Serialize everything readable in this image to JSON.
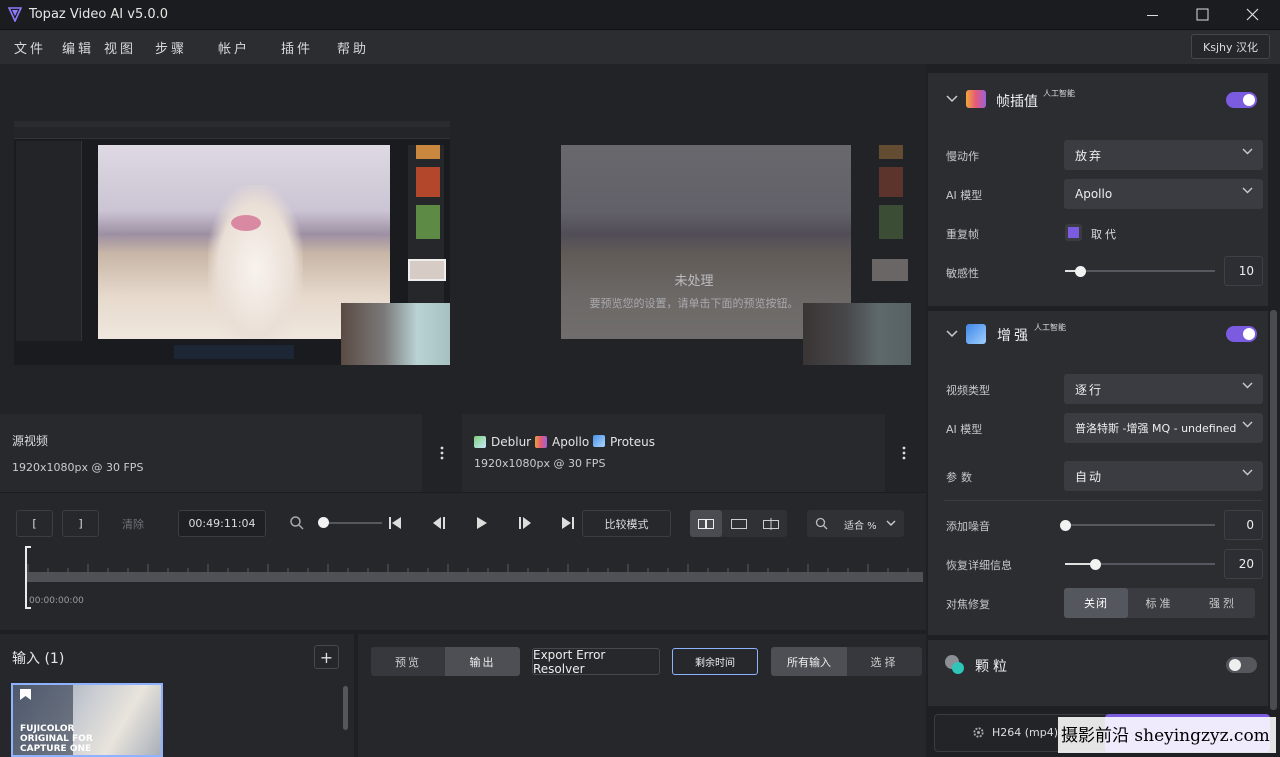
{
  "app": {
    "title": "Topaz Video AI  v5.0.0"
  },
  "menu": {
    "items": [
      "文件",
      "编辑",
      "视图",
      "步骤",
      "帐户",
      "插件",
      "帮助"
    ],
    "account_button": "Ksjhy 汉化"
  },
  "preview": {
    "source": {
      "title": "源视频",
      "resolution": "1920x1080px @ 30 FPS"
    },
    "output": {
      "badge": "未处理",
      "hint": "要预览您的设置，请单击下面的预览按钮。",
      "models": [
        "Deblur",
        "Apollo",
        "Proteus"
      ],
      "resolution": "1920x1080px @ 30 FPS"
    }
  },
  "timeline": {
    "in_label": "[",
    "out_label": "]",
    "clear_label": "清除",
    "timecode": "00:49:11:04",
    "compare_label": "比较模式",
    "zoom_label": "适合 %",
    "start_timecode": "00:00:00:00"
  },
  "inputs": {
    "title": "输入 (1)",
    "add_label": "+"
  },
  "thumbnail": {
    "lines": [
      "FUJICOLOR",
      "ORIGINAL FOR",
      "CAPTURE ONE"
    ]
  },
  "actions": {
    "preview_tab": "预览",
    "output_tab": "输出",
    "error_resolver": "Export Error Resolver",
    "time_remaining": "剩余时间",
    "all_inputs": "所有输入",
    "select": "选择"
  },
  "frame_interp": {
    "title": "帧插值",
    "badge": "人工智能",
    "enabled": true,
    "slowmo": {
      "label": "慢动作",
      "value": "放弃"
    },
    "ai_model": {
      "label": "AI 模型",
      "value": "Apollo"
    },
    "dup_frames": {
      "label": "重复帧",
      "value": "取代"
    },
    "sensitivity": {
      "label": "敏感性",
      "value": "10",
      "fraction": 0.1
    }
  },
  "enhance": {
    "title": "增强",
    "badge": "人工智能",
    "enabled": true,
    "video_type": {
      "label": "视频类型",
      "value": "逐行"
    },
    "ai_model": {
      "label": "AI 模型",
      "value": "普洛特斯 -增强 MQ - undefined"
    },
    "params": {
      "label": "参数",
      "value": "自动"
    },
    "noise": {
      "label": "添加噪音",
      "value": "0",
      "fraction": 0.0
    },
    "detail": {
      "label": "恢复详细信息",
      "value": "20",
      "fraction": 0.2
    },
    "focus_fix": {
      "label": "对焦修复",
      "options": [
        "关闭",
        "标准",
        "强烈"
      ],
      "selected": 0
    }
  },
  "grain": {
    "title": "颗粒",
    "enabled": false
  },
  "export": {
    "format": "H264 (mp4)"
  },
  "watermark": {
    "text": "摄影前沿 sheyingzyz.com"
  },
  "colors": {
    "accent": "#7b5be0",
    "toggle_off": "#55575d",
    "panel": "#2b2d31",
    "dark": "#1b1c1f"
  }
}
